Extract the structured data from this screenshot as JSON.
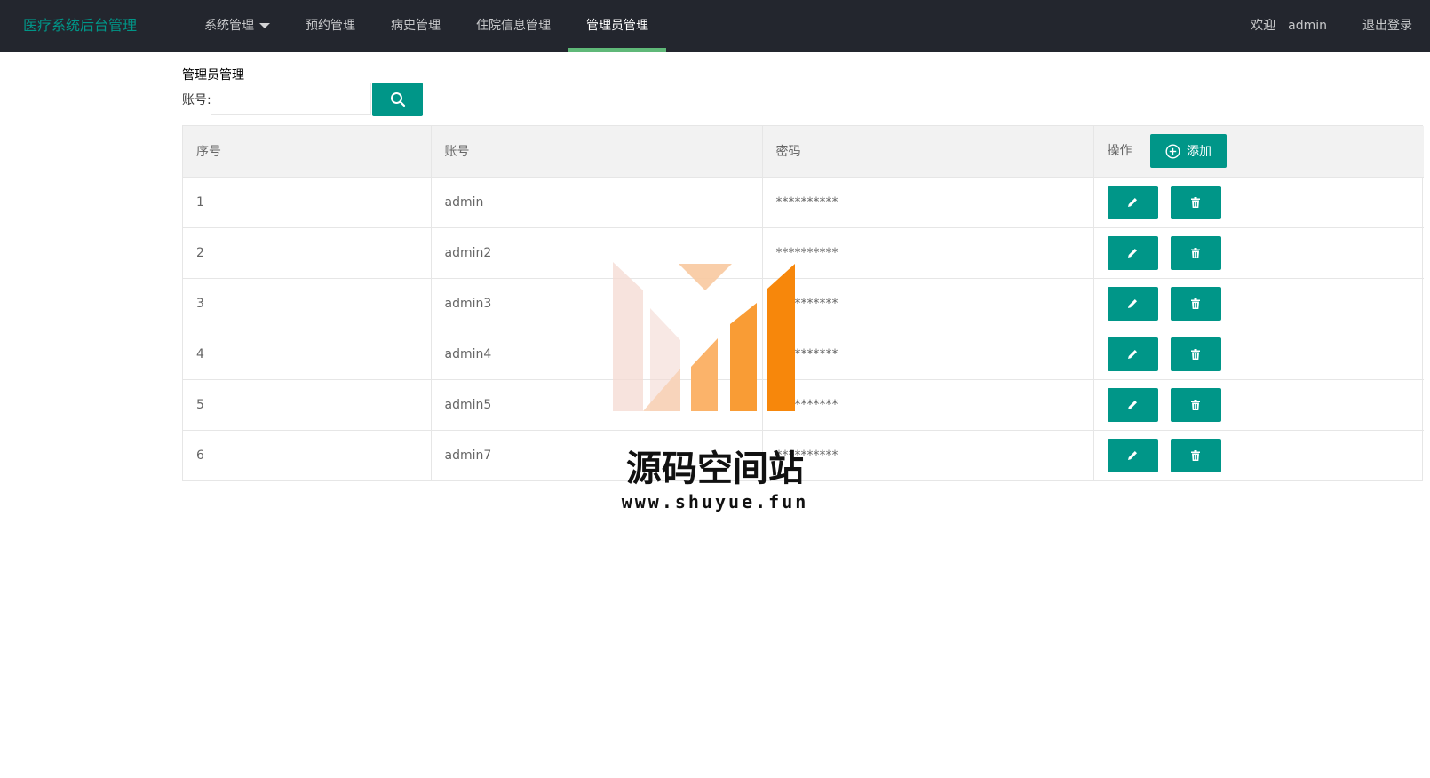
{
  "header": {
    "brand": "医疗系统后台管理",
    "nav": [
      {
        "label": "系统管理",
        "has_dropdown": true
      },
      {
        "label": "预约管理"
      },
      {
        "label": "病史管理"
      },
      {
        "label": "住院信息管理"
      },
      {
        "label": "管理员管理",
        "active": true
      }
    ],
    "welcome": "欢迎",
    "user": "admin",
    "logout": "退出登录"
  },
  "section_title": "管理员管理",
  "search": {
    "label": "账号:",
    "value": "",
    "placeholder": ""
  },
  "table": {
    "headers": {
      "index": "序号",
      "account": "账号",
      "password": "密码",
      "ops": "操作"
    },
    "add_label": "添加",
    "rows": [
      {
        "index": "1",
        "account": "admin",
        "password": "**********"
      },
      {
        "index": "2",
        "account": "admin2",
        "password": "**********"
      },
      {
        "index": "3",
        "account": "admin3",
        "password": "**********"
      },
      {
        "index": "4",
        "account": "admin4",
        "password": "**********"
      },
      {
        "index": "5",
        "account": "admin5",
        "password": "**********"
      },
      {
        "index": "6",
        "account": "admin7",
        "password": "**********"
      }
    ]
  },
  "watermark": {
    "title": "源码空间站",
    "url": "www.shuyue.fun"
  },
  "colors": {
    "accent": "#009688",
    "nav_bg": "#23262e",
    "active_bar": "#5fb878"
  },
  "icons": {
    "search": "search-icon",
    "add": "plus-circle-icon",
    "edit": "pencil-icon",
    "delete": "trash-icon"
  }
}
